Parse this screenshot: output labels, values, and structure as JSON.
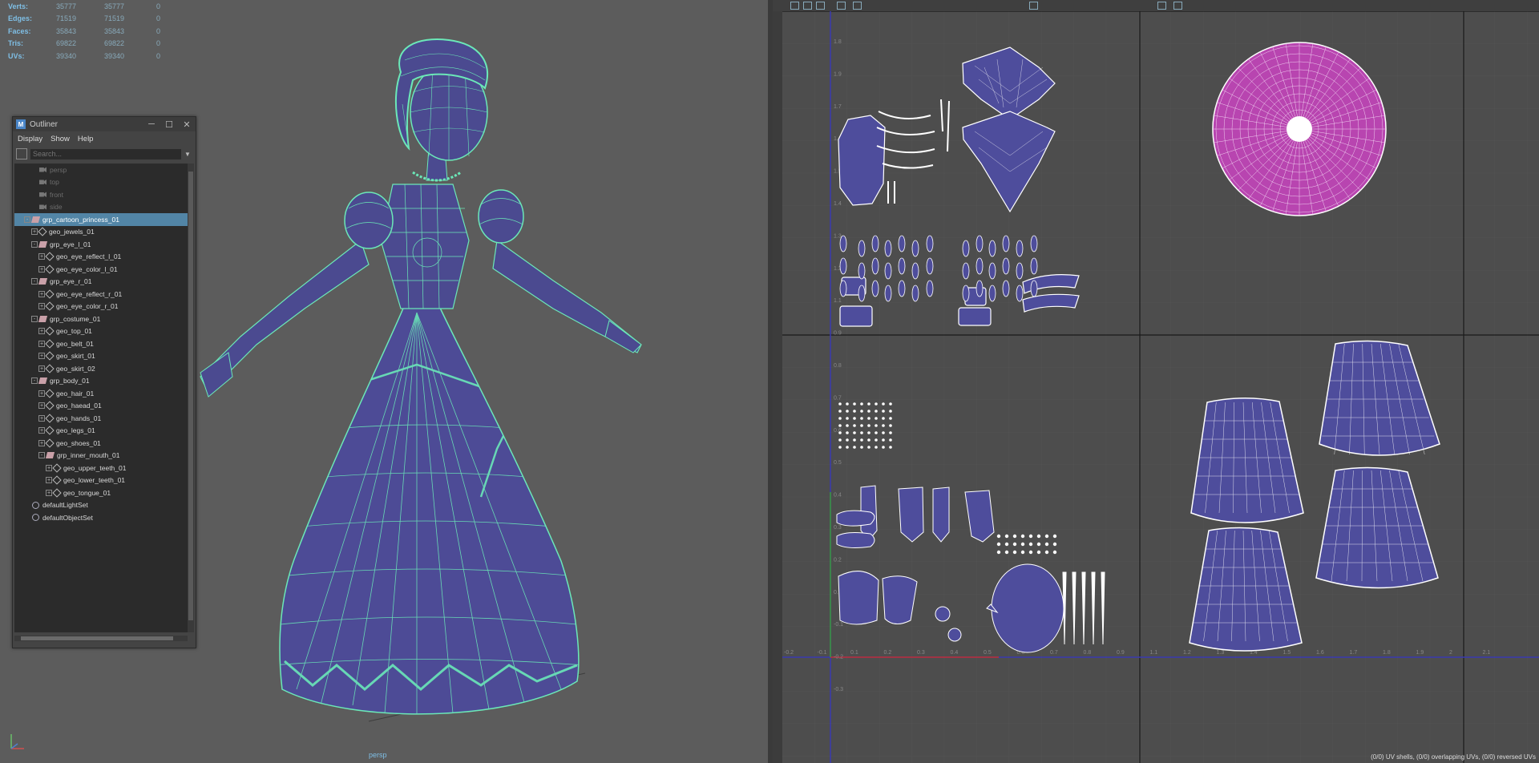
{
  "hud": {
    "rows": [
      {
        "label": "Verts:",
        "v1": "35777",
        "v2": "35777",
        "v3": "0"
      },
      {
        "label": "Edges:",
        "v1": "71519",
        "v2": "71519",
        "v3": "0"
      },
      {
        "label": "Faces:",
        "v1": "35843",
        "v2": "35843",
        "v3": "0"
      },
      {
        "label": "Tris:",
        "v1": "69822",
        "v2": "69822",
        "v3": "0"
      },
      {
        "label": "UVs:",
        "v1": "39340",
        "v2": "39340",
        "v3": "0"
      }
    ]
  },
  "viewport": {
    "camera_label": "persp"
  },
  "outliner": {
    "title": "Outliner",
    "menu": [
      "Display",
      "Show",
      "Help"
    ],
    "search_placeholder": "Search...",
    "items": [
      {
        "label": "persp",
        "type": "camera",
        "indent": 1,
        "dim": true
      },
      {
        "label": "top",
        "type": "camera",
        "indent": 1,
        "dim": true
      },
      {
        "label": "front",
        "type": "camera",
        "indent": 1,
        "dim": true
      },
      {
        "label": "side",
        "type": "camera",
        "indent": 1,
        "dim": true
      },
      {
        "label": "grp_cartoon_princess_01",
        "type": "group",
        "indent": 0,
        "expand": "-",
        "selected": true
      },
      {
        "label": "geo_jewels_01",
        "type": "mesh",
        "indent": 1,
        "expand": "+"
      },
      {
        "label": "grp_eye_l_01",
        "type": "group",
        "indent": 1,
        "expand": "-"
      },
      {
        "label": "geo_eye_reflect_l_01",
        "type": "mesh",
        "indent": 2,
        "expand": "+"
      },
      {
        "label": "geo_eye_color_l_01",
        "type": "mesh",
        "indent": 2,
        "expand": "+"
      },
      {
        "label": "grp_eye_r_01",
        "type": "group",
        "indent": 1,
        "expand": "-"
      },
      {
        "label": "geo_eye_reflect_r_01",
        "type": "mesh",
        "indent": 2,
        "expand": "+"
      },
      {
        "label": "geo_eye_color_r_01",
        "type": "mesh",
        "indent": 2,
        "expand": "+"
      },
      {
        "label": "grp_costume_01",
        "type": "group",
        "indent": 1,
        "expand": "-"
      },
      {
        "label": "geo_top_01",
        "type": "mesh",
        "indent": 2,
        "expand": "+"
      },
      {
        "label": "geo_belt_01",
        "type": "mesh",
        "indent": 2,
        "expand": "+"
      },
      {
        "label": "geo_skirt_01",
        "type": "mesh",
        "indent": 2,
        "expand": "+"
      },
      {
        "label": "geo_skirt_02",
        "type": "mesh",
        "indent": 2,
        "expand": "+"
      },
      {
        "label": "grp_body_01",
        "type": "group",
        "indent": 1,
        "expand": "-"
      },
      {
        "label": "geo_hair_01",
        "type": "mesh",
        "indent": 2,
        "expand": "+"
      },
      {
        "label": "geo_haead_01",
        "type": "mesh",
        "indent": 2,
        "expand": "+"
      },
      {
        "label": "geo_hands_01",
        "type": "mesh",
        "indent": 2,
        "expand": "+"
      },
      {
        "label": "geo_legs_01",
        "type": "mesh",
        "indent": 2,
        "expand": "+"
      },
      {
        "label": "geo_shoes_01",
        "type": "mesh",
        "indent": 2,
        "expand": "+"
      },
      {
        "label": "grp_inner_mouth_01",
        "type": "group",
        "indent": 2,
        "expand": "-"
      },
      {
        "label": "geo_upper_teeth_01",
        "type": "mesh",
        "indent": 3,
        "expand": "+"
      },
      {
        "label": "geo_lower_teeth_01",
        "type": "mesh",
        "indent": 3,
        "expand": "+"
      },
      {
        "label": "geo_tongue_01",
        "type": "mesh",
        "indent": 3,
        "expand": "+"
      },
      {
        "label": "defaultLightSet",
        "type": "set",
        "indent": 0
      },
      {
        "label": "defaultObjectSet",
        "type": "set",
        "indent": 0
      }
    ]
  },
  "uv_editor": {
    "side_label": "UV",
    "status": "(0/0) UV shells, (0/0) overlapping UVs, (0/0) reversed UVs",
    "tick_labels_v": [
      "1.8",
      "1.9",
      "1.7",
      "1.6",
      "1.5",
      "1.4",
      "1.3",
      "1.2",
      "1.1",
      "0.9",
      "0.8",
      "0.7",
      "0.6",
      "0.5",
      "0.4",
      "0.3",
      "0.2",
      "0.1",
      "-0.1",
      "-0.2",
      "-0.3"
    ],
    "tick_labels_u": [
      "-0.2",
      "-0.1",
      "0.1",
      "0.2",
      "0.3",
      "0.4",
      "0.5",
      "0.6",
      "0.7",
      "0.8",
      "0.9",
      "1.1",
      "1.2",
      "1.3",
      "1.4",
      "1.5",
      "1.6",
      "1.7",
      "1.8",
      "1.9",
      "2",
      "2.1"
    ]
  },
  "colors": {
    "mesh_fill": "#4b4a90",
    "wire": "#6be8b8",
    "uv_shell": "#4e4d9c",
    "uv_pink": "#b845b0",
    "selection": "#5285a6",
    "hud_text": "#7fbfe6"
  }
}
